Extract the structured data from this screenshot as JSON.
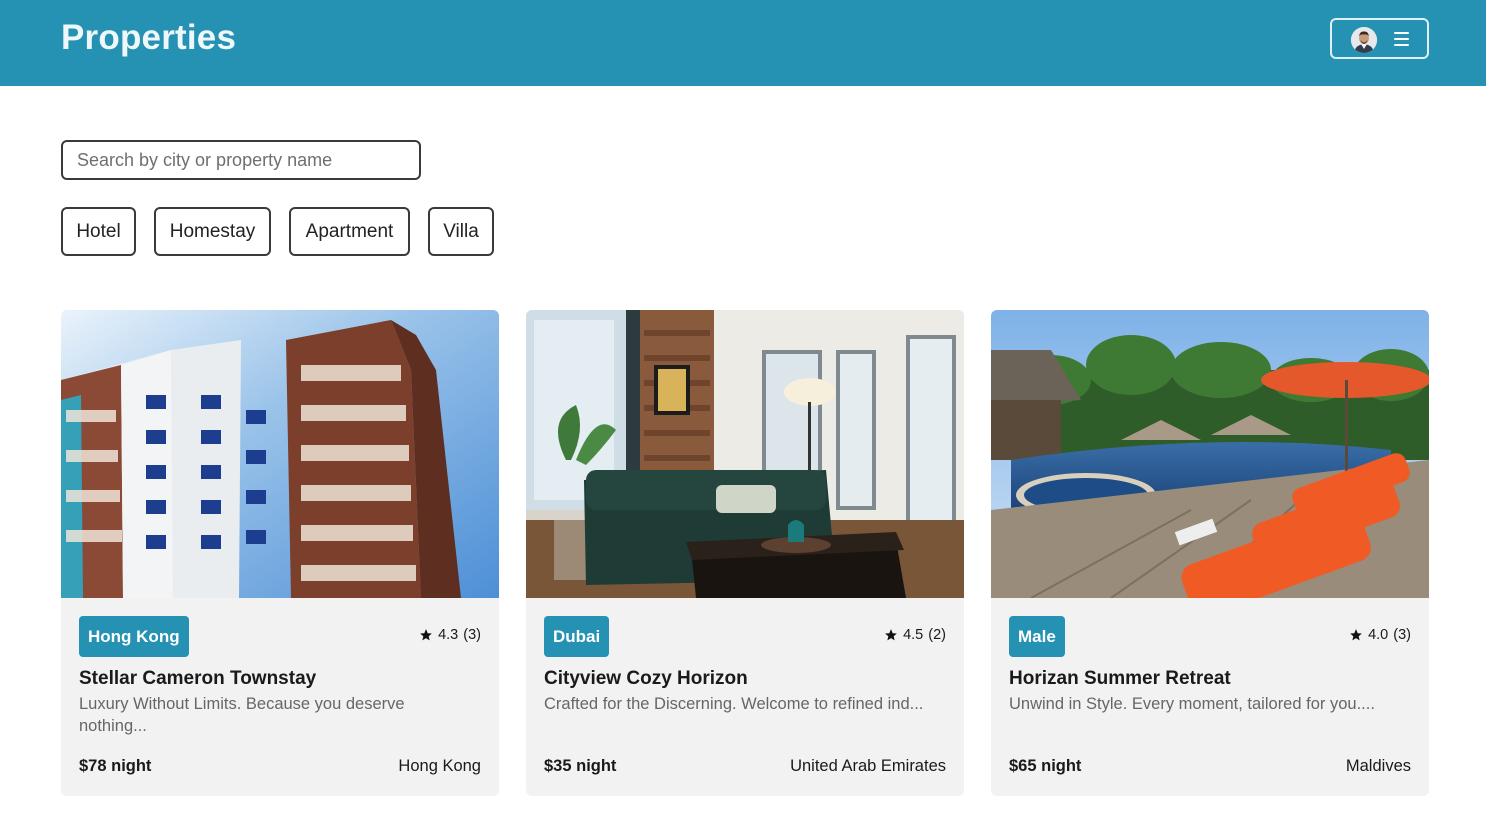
{
  "header": {
    "title": "Properties",
    "avatar_icon": "user-avatar-icon",
    "menu_icon": "hamburger-menu-icon",
    "background_color": "#2592b3"
  },
  "search": {
    "placeholder": "Search by city or property name",
    "value": ""
  },
  "filters": [
    "Hotel",
    "Homestay",
    "Apartment",
    "Villa"
  ],
  "properties": [
    {
      "city": "Hong Kong",
      "rating": "4.3",
      "reviews": "(3)",
      "name": "Stellar Cameron Townstay",
      "description": "Luxury Without Limits. Because you deserve nothing...",
      "price": "$78 night",
      "country": "Hong Kong"
    },
    {
      "city": "Dubai",
      "rating": "4.5",
      "reviews": "(2)",
      "name": "Cityview Cozy Horizon",
      "description": "Crafted for the Discerning. Welcome to refined ind...",
      "price": "$35 night",
      "country": "United Arab Emirates"
    },
    {
      "city": "Male",
      "rating": "4.0",
      "reviews": "(3)",
      "name": "Horizan Summer Retreat",
      "description": "Unwind in Style. Every moment, tailored for you....",
      "price": "$65 night",
      "country": "Maldives"
    }
  ],
  "colors": {
    "accent": "#2592b3",
    "card_background": "#f2f2f2",
    "muted_text": "#666666"
  }
}
